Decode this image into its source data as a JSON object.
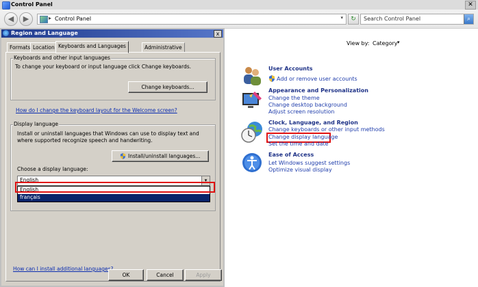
{
  "window": {
    "title": "Control Panel",
    "close_glyph": "✕"
  },
  "address_bar": {
    "location": "Control Panel",
    "separator": "▸",
    "search_placeholder": "Search Control Panel",
    "back_glyph": "◀",
    "forward_glyph": "▶",
    "dropdown_glyph": "▾",
    "refresh_glyph": "↻",
    "search_glyph": "⌕"
  },
  "view_by": {
    "label": "View by:",
    "value": "Category",
    "arrow": "▾"
  },
  "categories": [
    {
      "title": "User Accounts",
      "icon": "users-icon",
      "links": [
        "Add or remove user accounts"
      ]
    },
    {
      "title": "Appearance and Personalization",
      "icon": "appearance-icon",
      "links": [
        "Change the theme",
        "Change desktop background",
        "Adjust screen resolution"
      ]
    },
    {
      "title": "Clock, Language, and Region",
      "icon": "clock-globe-icon",
      "links": [
        "Change keyboards or other input methods",
        "Change display language",
        "Set the time and date"
      ]
    },
    {
      "title": "Ease of Access",
      "icon": "ease-of-access-icon",
      "links": [
        "Let Windows suggest settings",
        "Optimize visual display"
      ]
    }
  ],
  "dialog": {
    "title": "Region and Language",
    "close_glyph": "x",
    "tabs": [
      "Formats",
      "Location",
      "Keyboards and Languages",
      "Administrative"
    ],
    "active_tab": "Keyboards and Languages",
    "keyboards_group": {
      "label": "Keyboards and other input languages",
      "text": "To change your keyboard or input language click Change keyboards.",
      "button": "Change keyboards..."
    },
    "welcome_link": "How do I change the keyboard layout for the Welcome screen?",
    "display_group": {
      "label": "Display language",
      "text": "Install or uninstall languages that Windows can use to display text and where supported recognize speech and handwriting.",
      "button": "Install/uninstall languages...",
      "choose_label": "Choose a display language:",
      "selected": "English",
      "dd_glyph": "▾",
      "options": [
        "English",
        "français"
      ]
    },
    "install_link": "How can I install additional languages?",
    "buttons": {
      "ok": "OK",
      "cancel": "Cancel",
      "apply": "Apply"
    }
  },
  "colors": {
    "highlight_red": "#e01010",
    "link_blue": "#1e3cab",
    "category_title": "#1e3287",
    "selected_option_bg": "#0a246a"
  }
}
